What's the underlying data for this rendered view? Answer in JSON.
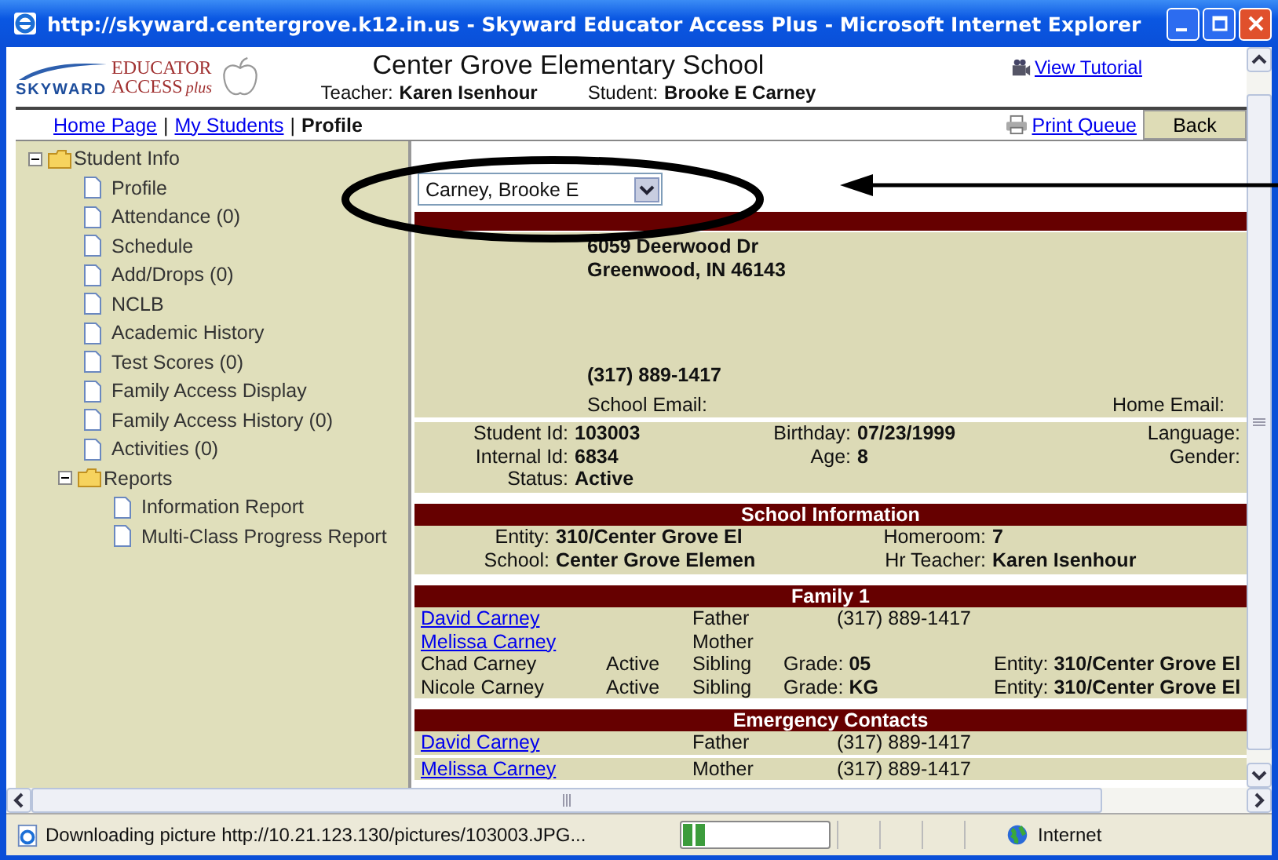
{
  "window": {
    "title": "http://skyward.centergrove.k12.in.us - Skyward Educator Access Plus - Microsoft Internet Explorer"
  },
  "logo": {
    "brand": "SKYWARD",
    "line1": "EDUCATOR",
    "line2": "ACCESS",
    "tag": "plus"
  },
  "header": {
    "school": "Center Grove Elementary School",
    "teacher_label": "Teacher:",
    "teacher": "Karen Isenhour",
    "student_label": "Student:",
    "student": "Brooke E Carney",
    "tutorial_link": "View Tutorial"
  },
  "nav": {
    "items": [
      {
        "label": "Home Page",
        "kind": "link"
      },
      {
        "label": "My Students",
        "kind": "link"
      },
      {
        "label": "Profile",
        "kind": "current"
      }
    ],
    "separator": "|",
    "print_link": "Print Queue",
    "back_button": "Back"
  },
  "sidebar": {
    "tree": [
      {
        "label": "Student Info",
        "expanded": true,
        "children": [
          {
            "label": "Profile"
          },
          {
            "label": "Attendance (0)"
          },
          {
            "label": "Schedule"
          },
          {
            "label": "Add/Drops (0)"
          },
          {
            "label": "NCLB"
          },
          {
            "label": "Academic History"
          },
          {
            "label": "Test Scores (0)"
          },
          {
            "label": "Family Access Display"
          },
          {
            "label": "Family Access History (0)"
          },
          {
            "label": "Activities (0)"
          },
          {
            "label": "Reports",
            "expanded": true,
            "children": [
              {
                "label": "Information Report"
              },
              {
                "label": "Multi-Class Progress Report"
              }
            ]
          }
        ]
      }
    ]
  },
  "student_select": {
    "value": "Carney, Brooke E"
  },
  "address": {
    "lines": [
      "6059 Deerwood Dr",
      "Greenwood, IN 46143"
    ],
    "phone": "(317) 889-1417",
    "school_email_label": "School Email:",
    "home_email_label": "Home Email:"
  },
  "student_info": {
    "columns": [
      [
        {
          "label": "Student Id:",
          "value": "103003"
        },
        {
          "label": "Internal Id:",
          "value": "6834"
        },
        {
          "label": "Status:",
          "value": "Active"
        }
      ],
      [
        {
          "label": "Birthday:",
          "value": "07/23/1999"
        },
        {
          "label": "Age:",
          "value": "8"
        }
      ],
      [
        {
          "label": "Language:"
        },
        {
          "label": "Gender:"
        }
      ]
    ]
  },
  "school_info": {
    "title": "School Information",
    "columns": [
      [
        {
          "label": "Entity:",
          "value": "310/Center Grove El"
        },
        {
          "label": "School:",
          "value": "Center Grove Elemen"
        }
      ],
      [
        {
          "label": "Homeroom:",
          "value": "7"
        },
        {
          "label": "Hr Teacher:",
          "value": "Karen Isenhour"
        }
      ]
    ]
  },
  "family": {
    "title": "Family 1",
    "members": [
      {
        "name": "David Carney",
        "kind": "link",
        "relation": "Father",
        "phone": "(317) 889-1417"
      },
      {
        "name": "Melissa Carney",
        "kind": "link",
        "relation": "Mother"
      },
      {
        "name": "Chad Carney",
        "kind": "plain",
        "status": "Active",
        "relation": "Sibling",
        "grade": {
          "label": "Grade:",
          "value": "05"
        },
        "entity": {
          "label": "Entity:",
          "value": "310/Center Grove El"
        }
      },
      {
        "name": "Nicole Carney",
        "kind": "plain",
        "status": "Active",
        "relation": "Sibling",
        "grade": {
          "label": "Grade:",
          "value": "KG"
        },
        "entity": {
          "label": "Entity:",
          "value": "310/Center Grove El"
        }
      }
    ]
  },
  "emergency": {
    "title": "Emergency Contacts",
    "contacts": [
      {
        "name": "David Carney",
        "kind": "link",
        "relation": "Father",
        "phone": "(317) 889-1417"
      },
      {
        "name": "Melissa Carney",
        "kind": "link",
        "relation": "Mother",
        "phone": "(317) 889-1417"
      }
    ]
  },
  "status_bar": {
    "text": "Downloading picture http://10.21.123.130/pictures/103003.JPG...",
    "progress": {
      "level": 0.15
    },
    "zone": "Internet"
  }
}
